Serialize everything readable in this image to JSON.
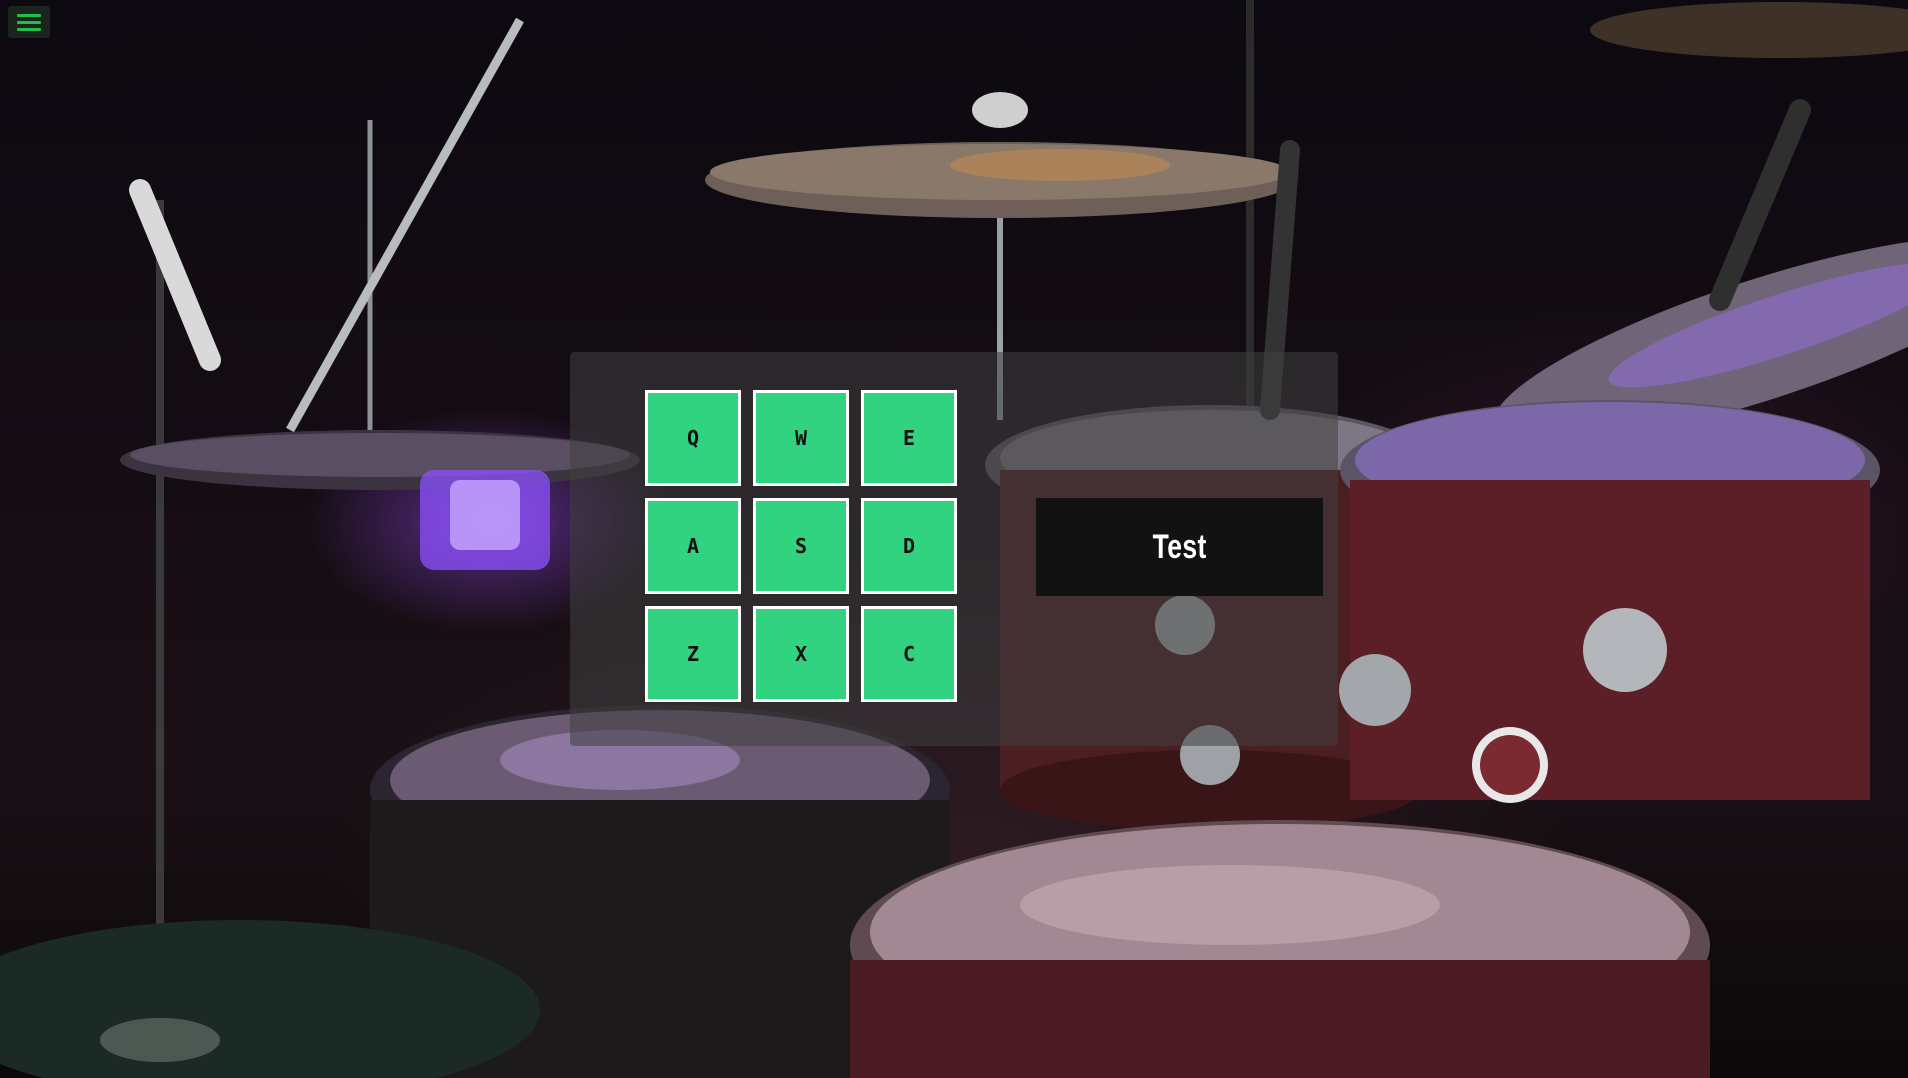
{
  "colors": {
    "pad_fill": "#31d380",
    "pad_border": "#ffffff",
    "menu_icon": "#1fbf4a",
    "display_bg": "#121212"
  },
  "menu": {
    "icon": "hamburger-menu-icon"
  },
  "pads": [
    {
      "key": "Q"
    },
    {
      "key": "W"
    },
    {
      "key": "E"
    },
    {
      "key": "A"
    },
    {
      "key": "S"
    },
    {
      "key": "D"
    },
    {
      "key": "Z"
    },
    {
      "key": "X"
    },
    {
      "key": "C"
    }
  ],
  "display": {
    "text": "Test"
  }
}
